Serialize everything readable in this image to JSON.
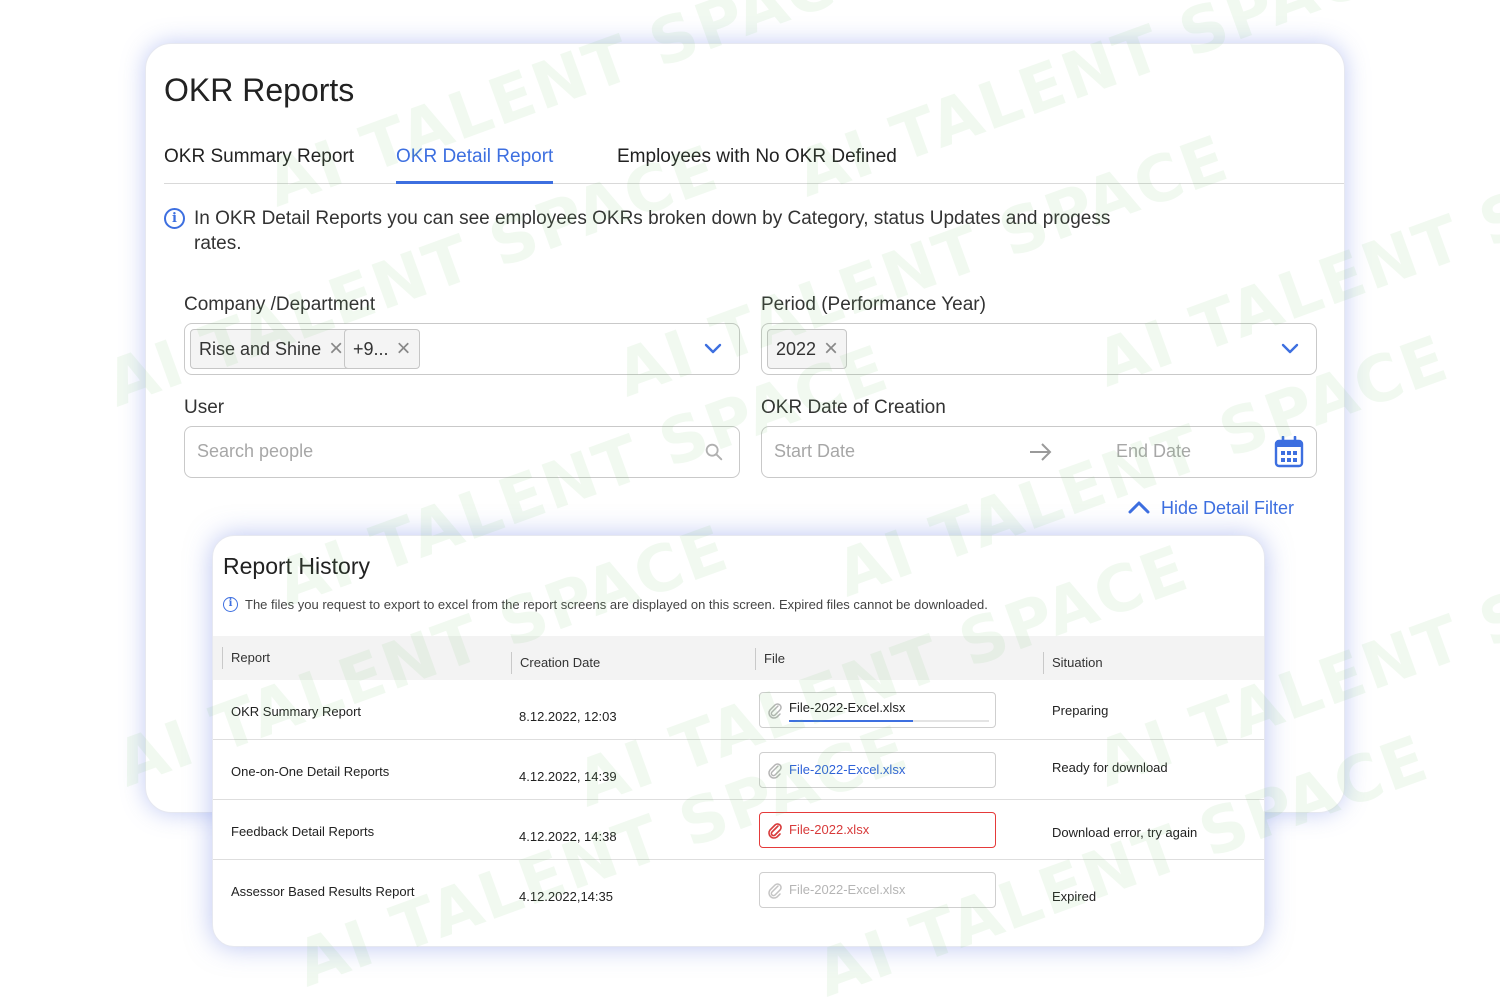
{
  "page": {
    "title": "OKR Reports",
    "tabs": [
      {
        "label": "OKR Summary Report",
        "active": false
      },
      {
        "label": "OKR Detail Report",
        "active": true
      },
      {
        "label": "Employees with No OKR Defined",
        "active": false
      }
    ],
    "info_text": "In OKR Detail Reports you can see employees OKRs broken down by Category, status Updates and progess rates."
  },
  "filters": {
    "company": {
      "label": "Company /Department",
      "chips": [
        "Rise and Shine",
        "+9..."
      ]
    },
    "period": {
      "label": "Period (Performance Year)",
      "chips": [
        "2022"
      ]
    },
    "user": {
      "label": "User",
      "placeholder": "Search people"
    },
    "date": {
      "label": "OKR Date of Creation",
      "start_placeholder": "Start Date",
      "end_placeholder": "End Date"
    },
    "toggle_label": "Hide Detail Filter"
  },
  "history": {
    "title": "Report History",
    "info": "The files you request to export to excel from the report screens are displayed on this screen. Expired files cannot be downloaded.",
    "columns": [
      "Report",
      "Creation Date",
      "File",
      "Situation"
    ],
    "rows": [
      {
        "report": "OKR Summary Report",
        "date": "8.12.2022, 12:03",
        "file": "File-2022-Excel.xlsx",
        "status": "Preparing",
        "state": "preparing",
        "progress": 0.62
      },
      {
        "report": "One-on-One Detail Reports",
        "date": "4.12.2022, 14:39",
        "file": "File-2022-Excel.xlsx",
        "status": "Ready for download",
        "state": "ready"
      },
      {
        "report": "Feedback Detail Reports",
        "date": "4.12.2022, 14:38",
        "file": "File-2022.xlsx",
        "status": "Download error, try again",
        "state": "error"
      },
      {
        "report": "Assessor Based Results Report",
        "date": "4.12.2022,14:35",
        "file": "File-2022-Excel.xlsx",
        "status": "Expired",
        "state": "expired"
      }
    ]
  },
  "watermark": "AI TALENT SPACE",
  "colors": {
    "accent": "#3d6fe0",
    "error": "#d83a3a",
    "shadow": "#7b8ce6",
    "watermark": "#78c86e"
  }
}
